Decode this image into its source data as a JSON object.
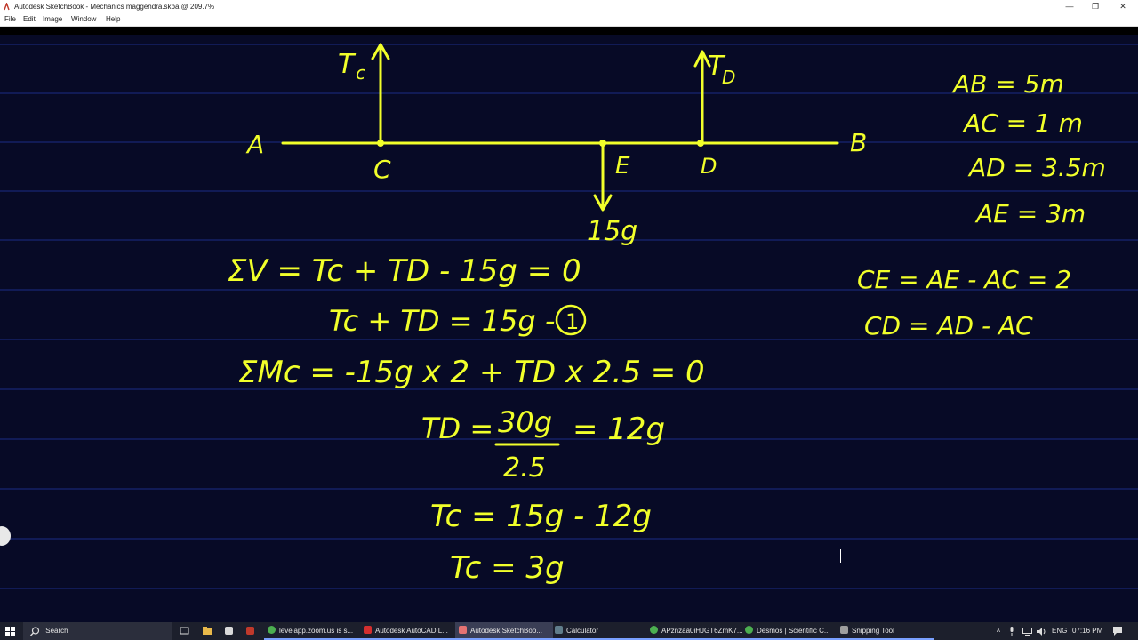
{
  "window": {
    "title": "Autodesk SketchBook - Mechanics maggendra.skba @ 209.7%",
    "controls": {
      "minimize": "—",
      "maximize": "❐",
      "close": "✕"
    }
  },
  "menu": [
    "File",
    "Edit",
    "Image",
    "Window",
    "Help"
  ],
  "sketch": {
    "beam": {
      "A": "A",
      "B": "B",
      "C": "C",
      "D": "D",
      "E": "E",
      "Tc": "T",
      "Tc_sub": "c",
      "Td": "T",
      "Td_sub": "D",
      "load": "15g"
    },
    "given": [
      "AB = 5m",
      "AC = 1 m",
      "AD = 3.5m",
      "AE = 3m"
    ],
    "derived": [
      "CE = AE - AC = 2",
      "CD = AD - AC"
    ],
    "eq1": "ΣV = Tc + TD - 15g = 0",
    "eq2": "Tc + TD = 15g -",
    "eq2_tag": "1",
    "eq3": "ΣMc = -15g x 2 + TD x 2.5 = 0",
    "eq4_lhs": "TD =",
    "eq4_num": "30g",
    "eq4_den": "2.5",
    "eq4_rhs": "= 12g",
    "eq5": "Tc = 15g - 12g",
    "eq6": "Tc = 3g"
  },
  "taskbar": {
    "search": "Search",
    "apps": [
      "levelapp.zoom.us is s...",
      "Autodesk AutoCAD L...",
      "Autodesk SketchBoo...",
      "Calculator",
      "APznzaa0iHJGT6ZmK7...",
      "Desmos | Scientific C...",
      "Snipping Tool"
    ],
    "lang": "ENG",
    "time": "07:16 PM"
  }
}
